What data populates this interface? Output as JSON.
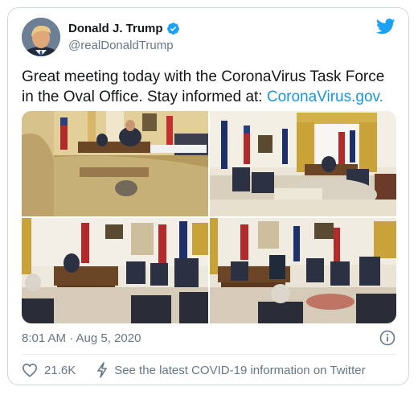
{
  "author": {
    "name": "Donald J. Trump",
    "handle": "@realDonaldTrump"
  },
  "tweet": {
    "text": "Great meeting today with the CoronaVirus Task Force in the Oval Office. Stay informed at: ",
    "link": "CoronaVirus.gov."
  },
  "meta": {
    "timestamp": "8:01 AM · Aug 5, 2020"
  },
  "actions": {
    "like_count": "21.6K",
    "covid_info": "See the latest COVID-19 information on Twitter"
  },
  "colors": {
    "brand": "#1da1f2",
    "link": "#1b95e0",
    "muted": "#657786",
    "text": "#14171a"
  },
  "icons": {
    "verified": "verified-badge-icon",
    "twitter": "twitter-bird-icon",
    "info": "info-icon",
    "like": "heart-icon",
    "covid": "lightning-bolt-icon"
  }
}
